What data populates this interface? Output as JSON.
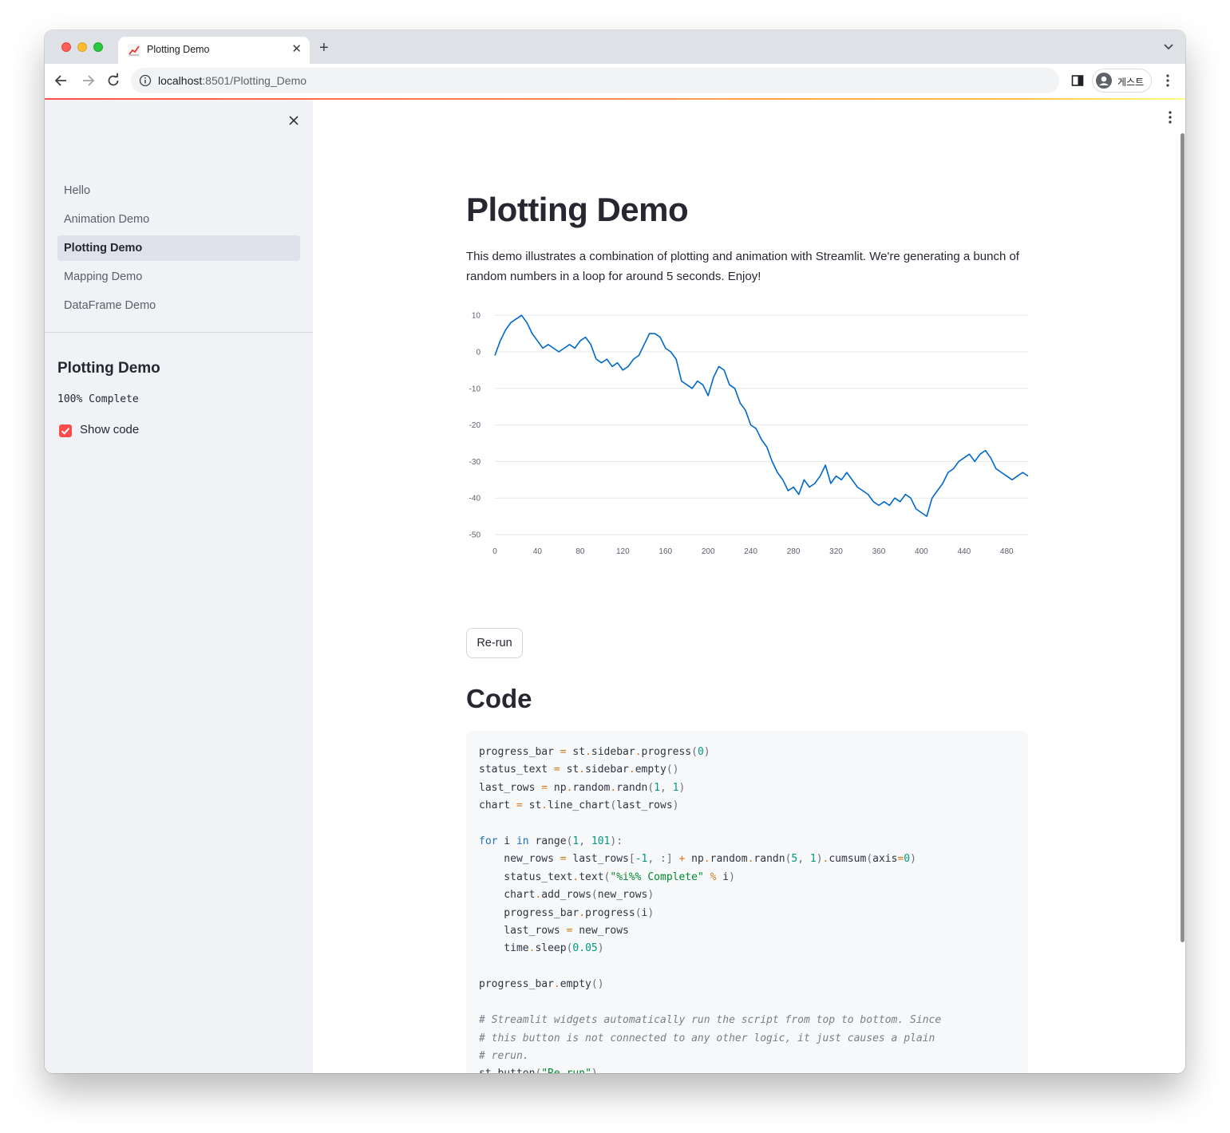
{
  "browser": {
    "tab_title": "Plotting Demo",
    "new_tab_label": "+",
    "url_host": "localhost",
    "url_path": ":8501/Plotting_Demo",
    "profile_name": "게스트"
  },
  "sidebar": {
    "nav_items": [
      {
        "label": "Hello",
        "active": false
      },
      {
        "label": "Animation Demo",
        "active": false
      },
      {
        "label": "Plotting Demo",
        "active": true
      },
      {
        "label": "Mapping Demo",
        "active": false
      },
      {
        "label": "DataFrame Demo",
        "active": false
      }
    ],
    "section_title": "Plotting Demo",
    "status_text": "100% Complete",
    "show_code_label": "Show code",
    "show_code_checked": true
  },
  "main": {
    "title": "Plotting Demo",
    "intro": "This demo illustrates a combination of plotting and animation with Streamlit. We're generating a bunch of random numbers in a loop for around 5 seconds. Enjoy!",
    "rerun_label": "Re-run",
    "code_heading": "Code"
  },
  "colors": {
    "accent": "#ff4b4b",
    "line": "#0068c9",
    "sidebar_bg": "#f0f2f6",
    "text": "#262730"
  },
  "chart_data": {
    "type": "line",
    "title": "",
    "xlabel": "",
    "ylabel": "",
    "xlim": [
      0,
      500
    ],
    "ylim": [
      -50,
      12
    ],
    "x_ticks": [
      0,
      40,
      80,
      120,
      160,
      200,
      240,
      280,
      320,
      360,
      400,
      440,
      480
    ],
    "y_ticks": [
      10,
      0,
      -10,
      -20,
      -30,
      -40,
      -50
    ],
    "grid": "horizontal",
    "series": [
      {
        "x": [
          0,
          5,
          10,
          15,
          20,
          25,
          30,
          35,
          40,
          45,
          50,
          55,
          60,
          65,
          70,
          75,
          80,
          85,
          90,
          95,
          100,
          105,
          110,
          115,
          120,
          125,
          130,
          135,
          140,
          145,
          150,
          155,
          160,
          165,
          170,
          175,
          180,
          185,
          190,
          195,
          200,
          205,
          210,
          215,
          220,
          225,
          230,
          235,
          240,
          245,
          250,
          255,
          260,
          265,
          270,
          275,
          280,
          285,
          290,
          295,
          300,
          305,
          310,
          315,
          320,
          325,
          330,
          335,
          340,
          345,
          350,
          355,
          360,
          365,
          370,
          375,
          380,
          385,
          390,
          395,
          400,
          405,
          410,
          415,
          420,
          425,
          430,
          435,
          440,
          445,
          450,
          455,
          460,
          465,
          470,
          475,
          480,
          485,
          490,
          495,
          500
        ],
        "values": [
          -1,
          3,
          6,
          8,
          9,
          10,
          8,
          5,
          3,
          1,
          2,
          1,
          0,
          1,
          2,
          1,
          3,
          4,
          2,
          -2,
          -3,
          -2,
          -4,
          -3,
          -5,
          -4,
          -2,
          -1,
          2,
          5,
          5,
          4,
          1,
          0,
          -2,
          -8,
          -9,
          -10,
          -8,
          -9,
          -12,
          -7,
          -4,
          -5,
          -9,
          -10,
          -14,
          -16,
          -20,
          -21,
          -24,
          -26,
          -30,
          -33,
          -35,
          -38,
          -37,
          -39,
          -35,
          -37,
          -36,
          -34,
          -31,
          -36,
          -34,
          -35,
          -33,
          -35,
          -37,
          -38,
          -39,
          -41,
          -42,
          -41,
          -42,
          -40,
          -41,
          -39,
          -40,
          -43,
          -44,
          -45,
          -40,
          -38,
          -36,
          -33,
          -32,
          -30,
          -29,
          -28,
          -30,
          -28,
          -27,
          -29,
          -32,
          -33,
          -34,
          -35,
          -34,
          -33,
          -34
        ]
      }
    ]
  },
  "code": [
    [
      [
        "progress_bar ",
        ""
      ],
      [
        "=",
        "op"
      ],
      [
        " st",
        ""
      ],
      [
        ".",
        "op"
      ],
      [
        "sidebar",
        ""
      ],
      [
        ".",
        "op"
      ],
      [
        "progress",
        ""
      ],
      [
        "(",
        "p"
      ],
      [
        "0",
        "num"
      ],
      [
        ")",
        "p"
      ]
    ],
    [
      [
        "status_text ",
        ""
      ],
      [
        "=",
        "op"
      ],
      [
        " st",
        ""
      ],
      [
        ".",
        "op"
      ],
      [
        "sidebar",
        ""
      ],
      [
        ".",
        "op"
      ],
      [
        "empty",
        ""
      ],
      [
        "()",
        "p"
      ]
    ],
    [
      [
        "last_rows ",
        ""
      ],
      [
        "=",
        "op"
      ],
      [
        " np",
        ""
      ],
      [
        ".",
        "op"
      ],
      [
        "random",
        ""
      ],
      [
        ".",
        "op"
      ],
      [
        "randn",
        ""
      ],
      [
        "(",
        "p"
      ],
      [
        "1",
        "num"
      ],
      [
        ", ",
        "p"
      ],
      [
        "1",
        "num"
      ],
      [
        ")",
        "p"
      ]
    ],
    [
      [
        "chart ",
        ""
      ],
      [
        "=",
        "op"
      ],
      [
        " st",
        ""
      ],
      [
        ".",
        "op"
      ],
      [
        "line_chart",
        ""
      ],
      [
        "(",
        "p"
      ],
      [
        "last_rows",
        ""
      ],
      [
        ")",
        "p"
      ]
    ],
    [],
    [
      [
        "for",
        "kw"
      ],
      [
        " i ",
        ""
      ],
      [
        "in",
        "kw"
      ],
      [
        " range",
        ""
      ],
      [
        "(",
        "p"
      ],
      [
        "1",
        "num"
      ],
      [
        ", ",
        "p"
      ],
      [
        "101",
        "num"
      ],
      [
        "):",
        "p"
      ]
    ],
    [
      [
        "    new_rows ",
        ""
      ],
      [
        "=",
        "op"
      ],
      [
        " last_rows",
        ""
      ],
      [
        "[",
        "p"
      ],
      [
        "-1",
        "num"
      ],
      [
        ", :] ",
        "p"
      ],
      [
        "+",
        "op"
      ],
      [
        " np",
        ""
      ],
      [
        ".",
        "op"
      ],
      [
        "random",
        ""
      ],
      [
        ".",
        "op"
      ],
      [
        "randn",
        ""
      ],
      [
        "(",
        "p"
      ],
      [
        "5",
        "num"
      ],
      [
        ", ",
        "p"
      ],
      [
        "1",
        "num"
      ],
      [
        ")",
        "p"
      ],
      [
        ".",
        "op"
      ],
      [
        "cumsum",
        ""
      ],
      [
        "(",
        "p"
      ],
      [
        "axis",
        ""
      ],
      [
        "=",
        "op"
      ],
      [
        "0",
        "num"
      ],
      [
        ")",
        "p"
      ]
    ],
    [
      [
        "    status_text",
        ""
      ],
      [
        ".",
        "op"
      ],
      [
        "text",
        ""
      ],
      [
        "(",
        "p"
      ],
      [
        "\"%i%% Complete\"",
        "str"
      ],
      [
        " % ",
        "op"
      ],
      [
        "i",
        ""
      ],
      [
        ")",
        "p"
      ]
    ],
    [
      [
        "    chart",
        ""
      ],
      [
        ".",
        "op"
      ],
      [
        "add_rows",
        ""
      ],
      [
        "(",
        "p"
      ],
      [
        "new_rows",
        ""
      ],
      [
        ")",
        "p"
      ]
    ],
    [
      [
        "    progress_bar",
        ""
      ],
      [
        ".",
        "op"
      ],
      [
        "progress",
        ""
      ],
      [
        "(",
        "p"
      ],
      [
        "i",
        ""
      ],
      [
        ")",
        "p"
      ]
    ],
    [
      [
        "    last_rows ",
        ""
      ],
      [
        "=",
        "op"
      ],
      [
        " new_rows",
        ""
      ]
    ],
    [
      [
        "    time",
        ""
      ],
      [
        ".",
        "op"
      ],
      [
        "sleep",
        ""
      ],
      [
        "(",
        "p"
      ],
      [
        "0.05",
        "num"
      ],
      [
        ")",
        "p"
      ]
    ],
    [],
    [
      [
        "progress_bar",
        ""
      ],
      [
        ".",
        "op"
      ],
      [
        "empty",
        ""
      ],
      [
        "()",
        "p"
      ]
    ],
    [],
    [
      [
        "# Streamlit widgets automatically run the script from top to bottom. Since",
        "cm"
      ]
    ],
    [
      [
        "# this button is not connected to any other logic, it just causes a plain",
        "cm"
      ]
    ],
    [
      [
        "# rerun.",
        "cm"
      ]
    ],
    [
      [
        "st",
        ""
      ],
      [
        ".",
        "op"
      ],
      [
        "button",
        ""
      ],
      [
        "(",
        "p"
      ],
      [
        "\"Re-run\"",
        "str"
      ],
      [
        ")",
        "p"
      ]
    ]
  ]
}
